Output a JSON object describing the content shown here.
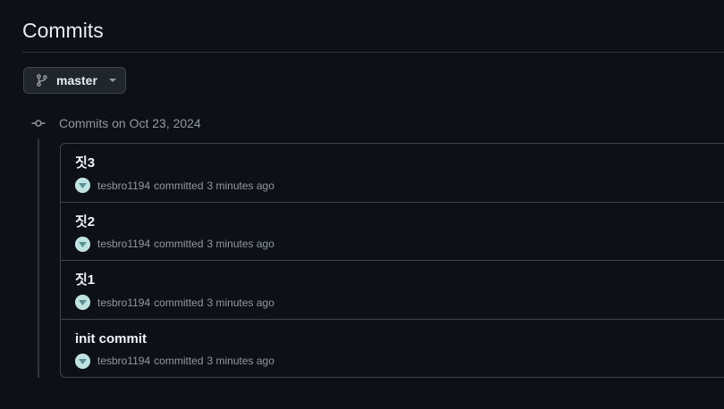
{
  "page": {
    "title": "Commits"
  },
  "branch": {
    "label": "master"
  },
  "group": {
    "heading": "Commits on Oct 23, 2024"
  },
  "commits": [
    {
      "message": "짓3",
      "author": "tesbro1194",
      "action": "committed",
      "time": "3 minutes ago"
    },
    {
      "message": "짓2",
      "author": "tesbro1194",
      "action": "committed",
      "time": "3 minutes ago"
    },
    {
      "message": "짓1",
      "author": "tesbro1194",
      "action": "committed",
      "time": "3 minutes ago"
    },
    {
      "message": "init commit",
      "author": "tesbro1194",
      "action": "committed",
      "time": "3 minutes ago"
    }
  ],
  "colors": {
    "background": "#0d1117",
    "border": "#3d444d",
    "muted_text": "#9198a1",
    "avatar": "#bfe3e1"
  },
  "icons": {
    "branch": "git-branch-icon",
    "caret": "caret-down-icon",
    "timeline": "git-commit-icon"
  }
}
